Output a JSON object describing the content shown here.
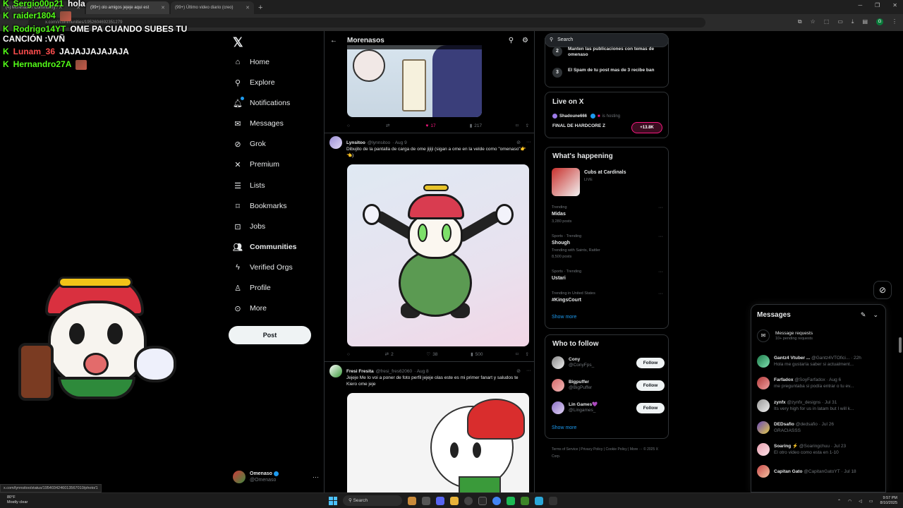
{
  "browser": {
    "tabs": [
      {
        "label": "(4) Morenasos Community / X",
        "active": true
      },
      {
        "label": "(99+) olo amigos jejeje aqui est",
        "active": false
      },
      {
        "label": "(99+) Último video diario (creo)",
        "active": false
      }
    ],
    "url": "x.com/i/communities/1952604692351279"
  },
  "chat": [
    {
      "user": "Sergio00p21",
      "user_color": "#53fc18",
      "message": "hola",
      "emote": false
    },
    {
      "user": "raider1804",
      "user_color": "#53fc18",
      "message": "",
      "emote": true
    },
    {
      "user": "Rodrigo14YT",
      "user_color": "#53fc18",
      "message": "OME PA CUANDO SUBES TU",
      "message2": "CANCIÓN :VVÑ",
      "emote": false
    },
    {
      "user": "Lunam_36",
      "user_color": "#ff4d4d",
      "message": "JAJAJJAJAJAJA",
      "emote": false
    },
    {
      "user": "Hernandro27A",
      "user_color": "#53fc18",
      "message": "",
      "emote": true
    }
  ],
  "nav": {
    "items": [
      {
        "label": "Home",
        "icon": "home-icon"
      },
      {
        "label": "Explore",
        "icon": "search-icon"
      },
      {
        "label": "Notifications",
        "icon": "bell-icon"
      },
      {
        "label": "Messages",
        "icon": "envelope-icon"
      },
      {
        "label": "Grok",
        "icon": "grok-icon"
      },
      {
        "label": "Premium",
        "icon": "x-icon"
      },
      {
        "label": "Lists",
        "icon": "list-icon"
      },
      {
        "label": "Bookmarks",
        "icon": "bookmark-icon"
      },
      {
        "label": "Jobs",
        "icon": "briefcase-icon"
      },
      {
        "label": "Communities",
        "icon": "people-icon"
      },
      {
        "label": "Verified Orgs",
        "icon": "lightning-icon"
      },
      {
        "label": "Profile",
        "icon": "person-icon"
      },
      {
        "label": "More",
        "icon": "more-circle-icon"
      }
    ],
    "post_label": "Post",
    "account": {
      "name": "Omenaso",
      "handle": "@Omenaso",
      "more": "···"
    }
  },
  "main": {
    "title": "Morenasos",
    "tweet1_actions": {
      "reply": "",
      "repost": "",
      "likes": "17",
      "views": "217"
    },
    "tweet2": {
      "name": "Lynsitoo",
      "handle": "@lynnsitoo",
      "date": "· Aug 9",
      "text": "Dibujito de la pantalla de carga de ome jijiji (sigan a ome en la velde como \"omenaso\"👉👈)",
      "actions": {
        "reply": "",
        "repost": "2",
        "likes": "38",
        "views": "500"
      }
    },
    "tweet3": {
      "name": "Fresi Fresita",
      "handle": "@fresi_fres62060",
      "date": "· Aug 8",
      "text": "Jejeje Me lo voi a poner de foto perfil jejeje olas este es mi primer fanart y saludos te Kiero ome jeje"
    }
  },
  "right": {
    "search_placeholder": "Search",
    "rules": [
      {
        "n": "2",
        "text": "Manten las publicaciones con temas de omenaso"
      },
      {
        "n": "3",
        "text": "El Spam de tu post mas de 3 recibe ban"
      }
    ],
    "live": {
      "title": "Live on X",
      "host": "Shadoune666",
      "host_suffix": "is hosting",
      "space": "FINAL DE HARDCORE Z",
      "listeners": "+13.8K"
    },
    "happening": {
      "title": "What's happening",
      "featured": {
        "title": "Cubs at Cardinals",
        "status": "LIVE"
      },
      "trends": [
        {
          "category": "Trending",
          "name": "Midas",
          "posts": "3,280 posts",
          "with": ""
        },
        {
          "category": "Sports · Trending",
          "name": "Shough",
          "posts": "8,500 posts",
          "with": "Trending with Saints, Rattler"
        },
        {
          "category": "Sports · Trending",
          "name": "Ustari",
          "posts": "",
          "with": ""
        },
        {
          "category": "Trending in United States",
          "name": "#KingsCourt",
          "posts": "",
          "with": ""
        }
      ],
      "show_more": "Show more"
    },
    "who_to_follow": {
      "title": "Who to follow",
      "users": [
        {
          "name": "Cony",
          "handle": "@ConyFps_",
          "button": "Follow"
        },
        {
          "name": "Bigpuffer",
          "handle": "@BigPuffer",
          "button": "Follow"
        },
        {
          "name": "Lin Games💜",
          "handle": "@Lingames_",
          "button": "Follow"
        }
      ],
      "show_more": "Show more"
    },
    "footer": "Terms of Service | Privacy Policy | Cookie Policy | More ··· © 2025 X Corp."
  },
  "messages": {
    "title": "Messages",
    "requests": {
      "label": "Message requests",
      "sub": "10+ pending requests"
    },
    "items": [
      {
        "name": "Gantz4 Vtuber ...",
        "meta": "@Gantz4VTOfici... · 22h",
        "preview": "Hola me gustaría saber si actualment..."
      },
      {
        "name": "Farfadox",
        "meta": "@SoyFarfadox · Aug 6",
        "preview": "me preguntaba si podía entrar o tu ev..."
      },
      {
        "name": "zynfx",
        "meta": "@zynfx_designs · Jul 31",
        "preview": "Its very high for us in latam but I will k..."
      },
      {
        "name": "DEDsafio",
        "meta": "@dedsafio · Jul 26",
        "preview": "GRACIASSS"
      },
      {
        "name": "Soaring ⚡",
        "meta": "@Soaringchuu · Jul 23",
        "preview": "El otro video como esta en 1-10"
      },
      {
        "name": "Capitan Gato",
        "meta": "@CapitanGatoYT · Jul 18",
        "preview": ""
      }
    ]
  },
  "status_url": "x.com/lynnsitoo/status/1954034246013567010/photo/1",
  "taskbar": {
    "weather_temp": "80°F",
    "weather_desc": "Mostly clear",
    "search": "Search",
    "time": "9:57 PM",
    "date": "8/10/2025"
  }
}
